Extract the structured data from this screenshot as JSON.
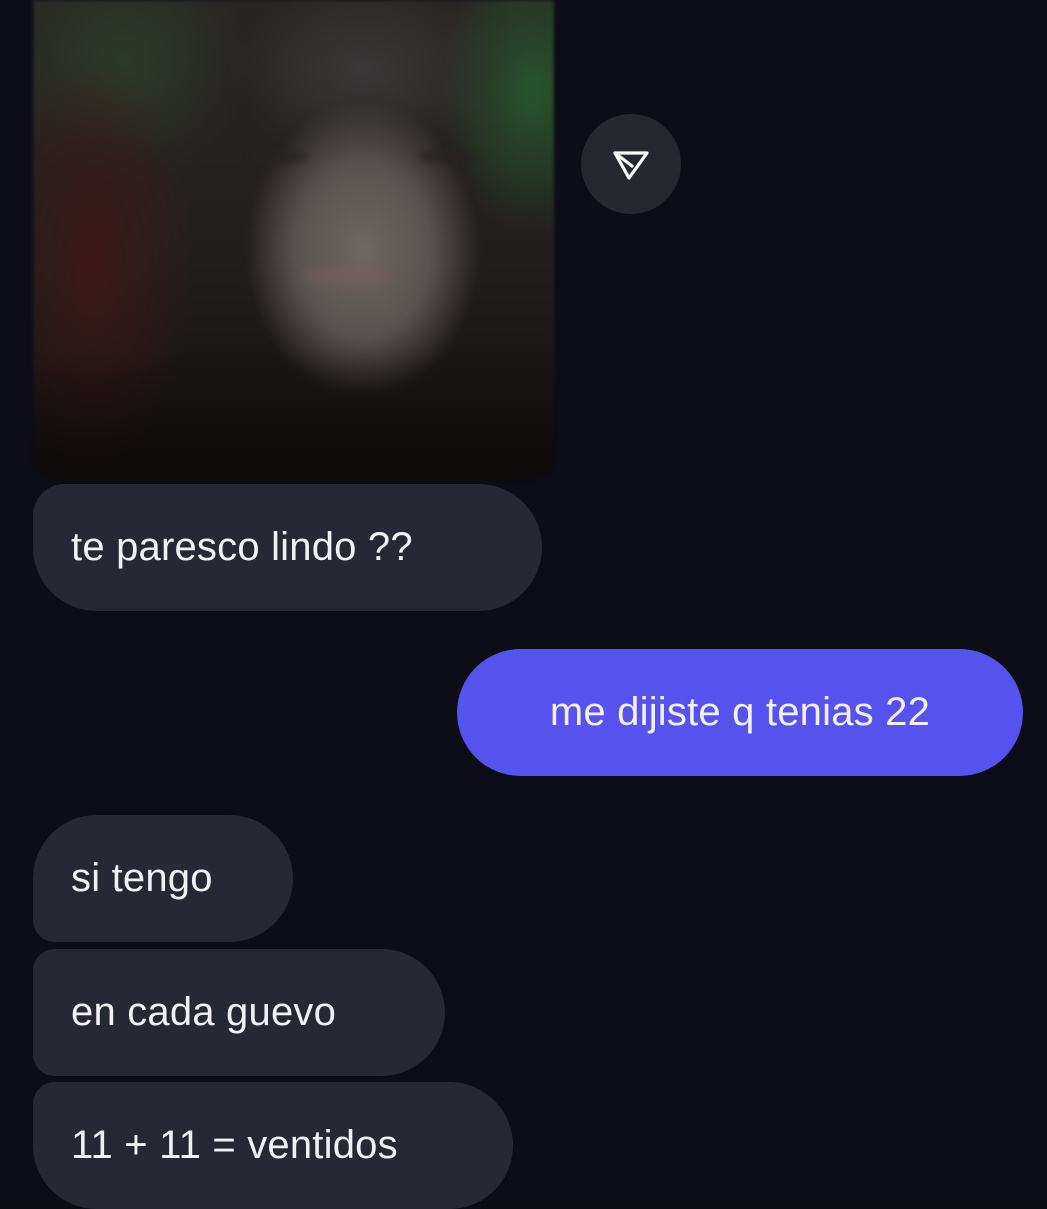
{
  "conversation": {
    "photo_message": {
      "media": "blurred-selfie-photo",
      "share_icon": "send-arrow-icon"
    },
    "messages": [
      {
        "direction": "incoming",
        "text": "te paresco lindo ??"
      },
      {
        "direction": "outgoing",
        "text": "me dijiste q tenias 22"
      },
      {
        "direction": "incoming",
        "text": "si tengo"
      },
      {
        "direction": "incoming",
        "text": "en cada guevo"
      },
      {
        "direction": "incoming",
        "text": "11 + 11 = ventidos"
      }
    ]
  },
  "colors": {
    "background": "#0c0d16",
    "incoming_bubble": "#262933",
    "outgoing_bubble": "#5552ee",
    "text": "#f1f1f4",
    "share_button": "#262830"
  }
}
